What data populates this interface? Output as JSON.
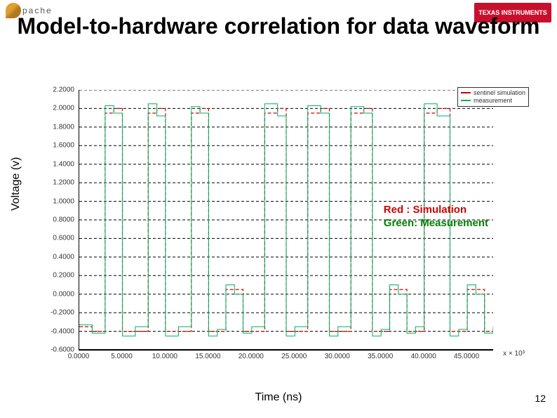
{
  "logo_left": "pache",
  "logo_right": "TEXAS INSTRUMENTS",
  "title": "Model-to-hardware correlation for data waveform",
  "ylabel": "Voltage (v)",
  "xlabel": "Time (ns)",
  "page_number": "12",
  "legend": {
    "sim": "sentinel simulation",
    "meas": "measurement"
  },
  "annotation": {
    "red": "Red : Simulation",
    "green": "Green: Measurement"
  },
  "x_unit_note": "x × 10³",
  "chart_data": {
    "type": "line",
    "xlabel": "Time (ns)",
    "ylabel": "Voltage (v)",
    "xlim": [
      0,
      48000
    ],
    "ylim": [
      -0.6,
      2.2
    ],
    "y_ticks": [
      2.2,
      2.0,
      1.8,
      1.6,
      1.4,
      1.2,
      1.0,
      0.8,
      0.6,
      0.4,
      0.2,
      0.0,
      -0.2,
      -0.4,
      -0.6
    ],
    "y_tick_labels": [
      "2.2000",
      "2.0000",
      "1.8000",
      "1.6000",
      "1.4000",
      "1.2000",
      "1.0000",
      "0.8000",
      "0.6000",
      "0.4000",
      "0.2000",
      "0.0000",
      "-0.2000",
      "-0.4000",
      "-0.6000"
    ],
    "x_ticks": [
      0,
      5000,
      10000,
      15000,
      20000,
      25000,
      30000,
      35000,
      40000,
      45000
    ],
    "x_tick_labels": [
      "0.0000",
      "5.0000",
      "10.0000",
      "15.0000",
      "20.0000",
      "25.0000",
      "30.0000",
      "35.0000",
      "40.0000",
      "45.0000"
    ],
    "series": [
      {
        "name": "simulation",
        "color": "#d00000",
        "x": [
          0,
          1500,
          3000,
          4000,
          5000,
          6500,
          8000,
          9000,
          10000,
          11500,
          13000,
          14000,
          15000,
          16000,
          17000,
          18000,
          19000,
          20000,
          21500,
          23000,
          24000,
          25000,
          26500,
          28000,
          29000,
          30000,
          31500,
          33000,
          34000,
          35000,
          36000,
          37000,
          38000,
          39000,
          40000,
          41500,
          43000,
          44000,
          45000,
          46000,
          47000,
          48000
        ],
        "y": [
          -0.35,
          -0.4,
          1.95,
          2.0,
          -0.4,
          -0.4,
          1.95,
          2.0,
          -0.4,
          -0.4,
          1.95,
          2.0,
          -0.4,
          -0.4,
          0.05,
          0.05,
          -0.4,
          -0.4,
          1.95,
          2.0,
          -0.4,
          -0.4,
          1.95,
          2.0,
          -0.4,
          -0.4,
          1.95,
          2.0,
          -0.4,
          -0.4,
          0.05,
          0.05,
          -0.4,
          -0.4,
          1.95,
          2.0,
          -0.4,
          -0.4,
          0.05,
          0.05,
          -0.4,
          -0.4
        ]
      },
      {
        "name": "measurement",
        "color": "#00b060",
        "x": [
          0,
          1500,
          3000,
          4000,
          5000,
          6500,
          8000,
          9000,
          10000,
          11500,
          13000,
          14000,
          15000,
          16000,
          17000,
          18000,
          19000,
          20000,
          21500,
          23000,
          24000,
          25000,
          26500,
          28000,
          29000,
          30000,
          31500,
          33000,
          34000,
          35000,
          36000,
          37000,
          38000,
          39000,
          40000,
          41500,
          43000,
          44000,
          45000,
          46000,
          47000,
          48000
        ],
        "y": [
          -0.33,
          -0.42,
          2.03,
          1.95,
          -0.45,
          -0.35,
          2.05,
          1.92,
          -0.45,
          -0.35,
          2.02,
          1.95,
          -0.45,
          -0.38,
          0.1,
          0.0,
          -0.42,
          -0.35,
          2.05,
          1.92,
          -0.45,
          -0.35,
          2.03,
          1.95,
          -0.45,
          -0.35,
          2.02,
          1.95,
          -0.45,
          -0.38,
          0.1,
          0.0,
          -0.42,
          -0.35,
          2.05,
          1.92,
          -0.45,
          -0.38,
          0.1,
          0.0,
          -0.42,
          -0.35
        ]
      }
    ]
  }
}
